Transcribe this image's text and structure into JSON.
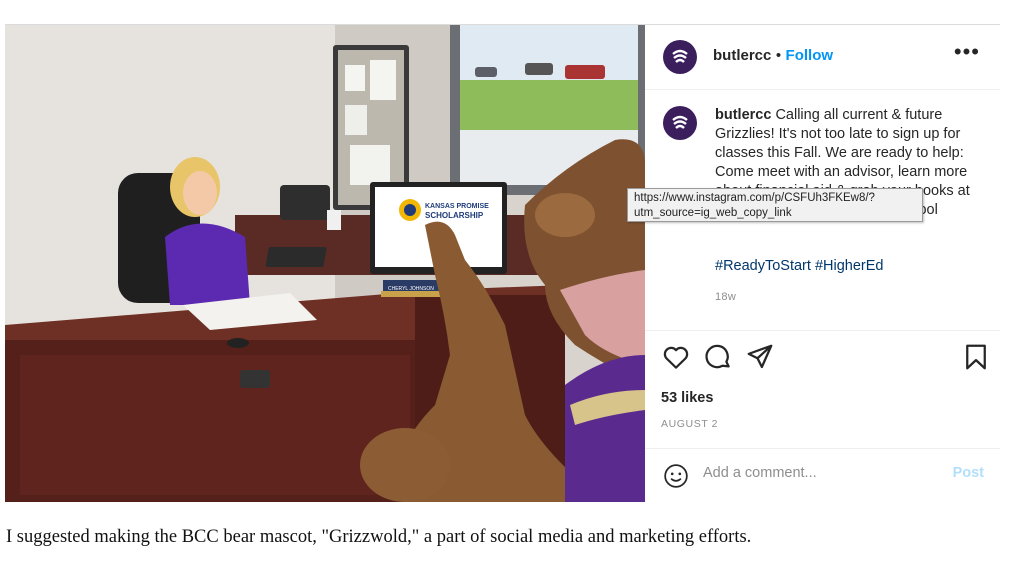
{
  "post": {
    "username": "butlercc",
    "separator": "•",
    "follow_label": "Follow",
    "more_icon": "•••",
    "caption_user": "butlercc",
    "caption_text": "Calling all current & future Grizzlies! It's not too late to sign up for classes this Fall. We are ready to help: Come meet with an advisor, learn more about financial aid & grab your books at the bookstore. Let's get this school",
    "tooltip_line1": "https://www.instagram.com/p/CSFUh3FKEw8/?",
    "tooltip_line2": "utm_source=ig_web_copy_link",
    "hashtags": [
      "#ReadyToStart",
      "#HigherEd"
    ],
    "age": "18w",
    "likes": "53 likes",
    "date": "AUGUST 2",
    "comment_placeholder": "Add a comment...",
    "post_label": "Post"
  },
  "photo": {
    "monitor_line1": "KANSAS PROMISE",
    "monitor_line2": "SCHOLARSHIP",
    "nameplate": "CHERYL JOHNSON"
  },
  "colors": {
    "brand_purple": "#3b1f5c",
    "link_blue": "#0095f6",
    "hashtag_blue": "#00376b"
  },
  "icons": [
    "more-options-icon",
    "heart-icon",
    "comment-icon",
    "share-icon",
    "bookmark-icon",
    "emoji-icon",
    "butlercc-logo-icon"
  ],
  "document": {
    "caption": "I suggested making the BCC bear mascot, \"Grizzwold,\" a part of social media and marketing efforts."
  }
}
